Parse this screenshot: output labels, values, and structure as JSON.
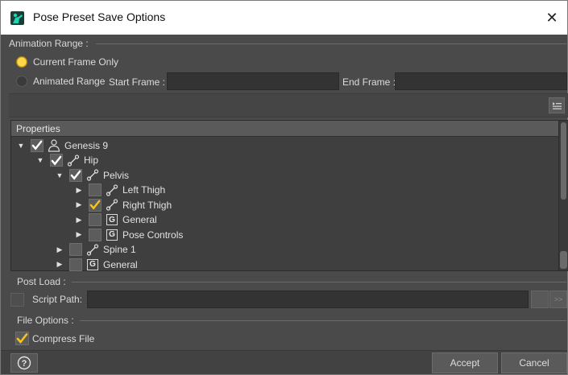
{
  "window": {
    "title": "Pose Preset Save Options",
    "close_glyph": "✕",
    "app_icon": "daz-figure-icon"
  },
  "animation_range": {
    "group_label": "Animation Range :",
    "current_frame_label": "Current Frame Only",
    "current_frame_selected": true,
    "animated_range_label": "Animated Range",
    "animated_range_selected": false,
    "start_frame_label": "Start Frame :",
    "start_frame_value": "",
    "end_frame_label": "End Frame :",
    "end_frame_value": ""
  },
  "properties": {
    "header": "Properties",
    "tree": [
      {
        "label": "Genesis 9",
        "icon": "figure-icon",
        "checked": true,
        "expanded": true,
        "depth": 0
      },
      {
        "label": "Hip",
        "icon": "bone-icon",
        "checked": true,
        "expanded": true,
        "depth": 1
      },
      {
        "label": "Pelvis",
        "icon": "bone-icon",
        "checked": true,
        "expanded": true,
        "depth": 2
      },
      {
        "label": "Left Thigh",
        "icon": "bone-icon",
        "checked": false,
        "expanded": false,
        "depth": 3
      },
      {
        "label": "Right Thigh",
        "icon": "bone-icon",
        "checked": true,
        "expanded": false,
        "depth": 3
      },
      {
        "label": "General",
        "icon": "group-icon",
        "checked": false,
        "expanded": false,
        "depth": 3
      },
      {
        "label": "Pose Controls",
        "icon": "group-icon",
        "checked": false,
        "expanded": false,
        "depth": 3
      },
      {
        "label": "Spine 1",
        "icon": "bone-icon",
        "checked": false,
        "expanded": false,
        "depth": 2
      },
      {
        "label": "General",
        "icon": "group-icon",
        "checked": false,
        "expanded": false,
        "depth": 2
      }
    ],
    "group_glyph": "G"
  },
  "post_load": {
    "group_label": "Post Load :",
    "script_path_label": "Script Path:",
    "script_path_value": "",
    "script_path_enabled": false,
    "browse_glyph": ">>"
  },
  "file_options": {
    "group_label": "File Options :",
    "compress_label": "Compress File",
    "compress_checked": true
  },
  "footer": {
    "help_glyph": "?",
    "accept_label": "Accept",
    "cancel_label": "Cancel"
  },
  "colors": {
    "check_yellow": "#f5c518",
    "check_white": "#ffffff",
    "panel": "#4a4a4a",
    "field": "#333333"
  }
}
